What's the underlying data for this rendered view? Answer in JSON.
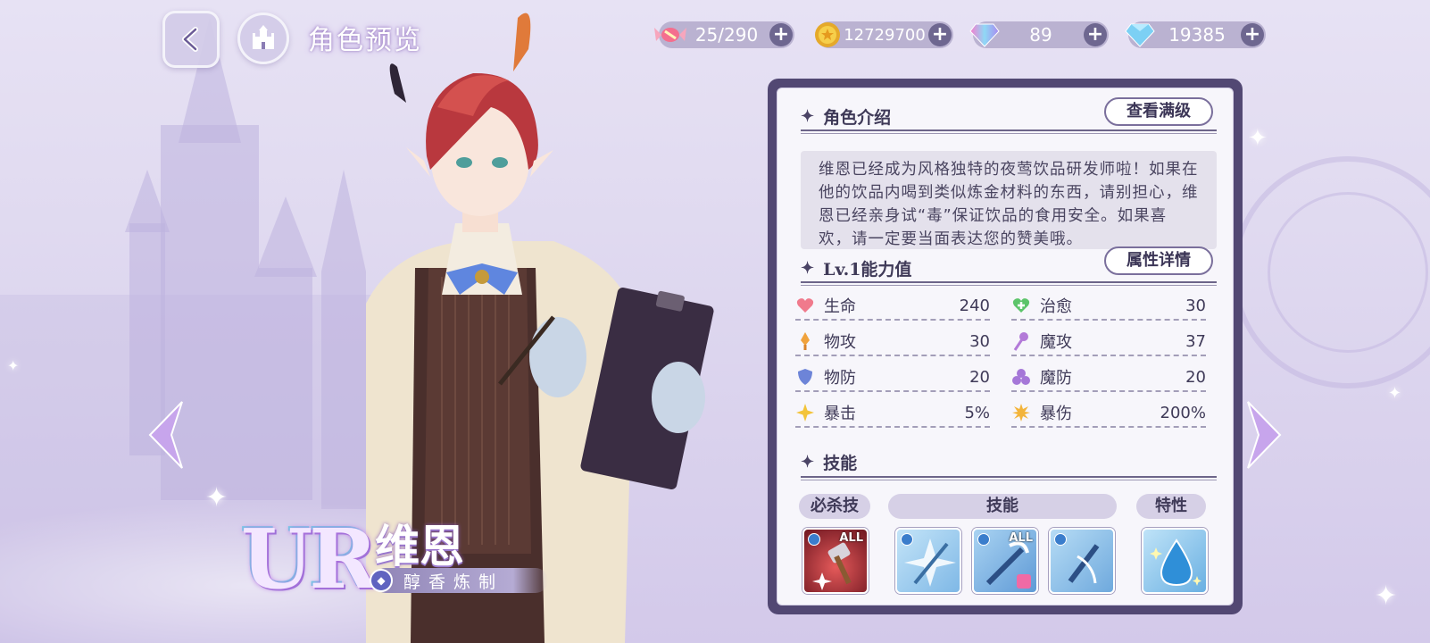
{
  "header": {
    "title": "角色预览",
    "back_icon": "back-arrow-icon",
    "home_icon": "castle-icon"
  },
  "currencies": [
    {
      "name": "stamina",
      "icon": "candy-icon",
      "value": "25/290"
    },
    {
      "name": "gold",
      "icon": "gold-coin-icon",
      "value": "12729700"
    },
    {
      "name": "rainbow-gem",
      "icon": "rainbow-diamond-icon",
      "value": "89"
    },
    {
      "name": "diamond",
      "icon": "blue-diamond-icon",
      "value": "19385"
    }
  ],
  "character": {
    "rarity": "UR",
    "name": "维恩",
    "title": "醇香炼制",
    "element_icon": "blue-element-icon"
  },
  "intro": {
    "section_title": "角色介绍",
    "button_label": "查看满级",
    "description": "维恩已经成为风格独特的夜莺饮品研发师啦！如果在他的饮品内喝到类似炼金材料的东西，请别担心，维恩已经亲身试“毒”保证饮品的食用安全。如果喜欢，请一定要当面表达您的赞美哦。"
  },
  "stats": {
    "section_title": "Lv.1能力值",
    "button_label": "属性详情",
    "items": [
      {
        "label": "生命",
        "value": "240",
        "icon": "heart-icon",
        "color": "#f07a8c"
      },
      {
        "label": "治愈",
        "value": "30",
        "icon": "heal-cross-icon",
        "color": "#5cc46a"
      },
      {
        "label": "物攻",
        "value": "30",
        "icon": "physical-attack-icon",
        "color": "#f0a23c"
      },
      {
        "label": "魔攻",
        "value": "37",
        "icon": "magic-attack-icon",
        "color": "#b37ad8"
      },
      {
        "label": "物防",
        "value": "20",
        "icon": "shield-icon",
        "color": "#6d84d8"
      },
      {
        "label": "魔防",
        "value": "20",
        "icon": "magic-defense-icon",
        "color": "#a577d8"
      },
      {
        "label": "暴击",
        "value": "5%",
        "icon": "crit-star-icon",
        "color": "#f3c43a"
      },
      {
        "label": "暴伤",
        "value": "200%",
        "icon": "crit-damage-icon",
        "color": "#f3b43a"
      }
    ]
  },
  "skills": {
    "section_title": "技能",
    "tags": {
      "ultimate": "必杀技",
      "skill": "技能",
      "trait": "特性"
    },
    "icons": [
      {
        "name": "ultimate-skill",
        "badge": "ALL"
      },
      {
        "name": "skill-1",
        "badge": ""
      },
      {
        "name": "skill-2",
        "badge": "ALL"
      },
      {
        "name": "skill-3",
        "badge": ""
      },
      {
        "name": "trait-water-drop",
        "badge": ""
      }
    ]
  },
  "colors": {
    "panel_frame": "#524873",
    "panel_bg": "#f7f6fb",
    "accent_purple": "#8f84b6"
  }
}
